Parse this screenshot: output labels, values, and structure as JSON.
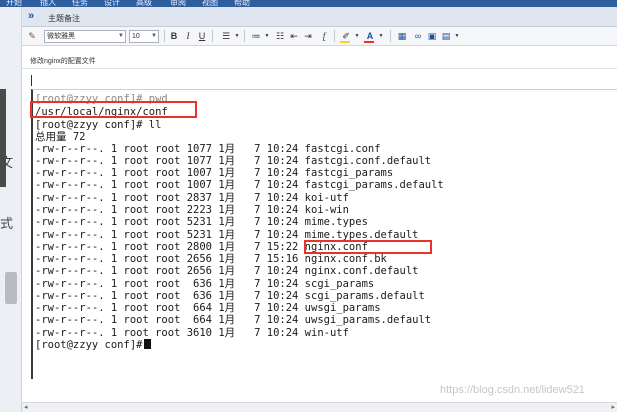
{
  "ribbon": {
    "tabs": [
      "开始",
      "插入",
      "任务",
      "设计",
      "高级",
      "审阅",
      "视图",
      "帮助"
    ]
  },
  "gutter": {
    "texts": [
      "文",
      "式"
    ]
  },
  "section": {
    "title": "主题备注"
  },
  "toolbar": {
    "font_name": "微软雅黑",
    "font_size": "10",
    "bold": "B",
    "italic": "I",
    "underline": "U",
    "font_color": "A",
    "highlight_color": "#f2d33a",
    "font_color_value": "#e8322a"
  },
  "note": {
    "title": "修改nginx的配置文件"
  },
  "terminal": {
    "lines": [
      "[root@zzyy conf]# pwd",
      "/usr/local/nginx/conf",
      "[root@zzyy conf]# ll",
      "总用量 72",
      "-rw-r--r--. 1 root root 1077 1月   7 10:24 fastcgi.conf",
      "-rw-r--r--. 1 root root 1077 1月   7 10:24 fastcgi.conf.default",
      "-rw-r--r--. 1 root root 1007 1月   7 10:24 fastcgi_params",
      "-rw-r--r--. 1 root root 1007 1月   7 10:24 fastcgi_params.default",
      "-rw-r--r--. 1 root root 2837 1月   7 10:24 koi-utf",
      "-rw-r--r--. 1 root root 2223 1月   7 10:24 koi-win",
      "-rw-r--r--. 1 root root 5231 1月   7 10:24 mime.types",
      "-rw-r--r--. 1 root root 5231 1月   7 10:24 mime.types.default",
      "-rw-r--r--. 1 root root 2800 1月   7 15:22 nginx.conf",
      "-rw-r--r--. 1 root root 2656 1月   7 15:16 nginx.conf.bk",
      "-rw-r--r--. 1 root root 2656 1月   7 10:24 nginx.conf.default",
      "-rw-r--r--. 1 root root  636 1月   7 10:24 scgi_params",
      "-rw-r--r--. 1 root root  636 1月   7 10:24 scgi_params.default",
      "-rw-r--r--. 1 root root  664 1月   7 10:24 uwsgi_params",
      "-rw-r--r--. 1 root root  664 1月   7 10:24 uwsgi_params.default",
      "-rw-r--r--. 1 root root 3610 1月   7 10:24 win-utf",
      "[root@zzyy conf]#"
    ],
    "highlight_color": "#e8322a"
  },
  "watermark": "https://blog.csdn.net/lidew521"
}
